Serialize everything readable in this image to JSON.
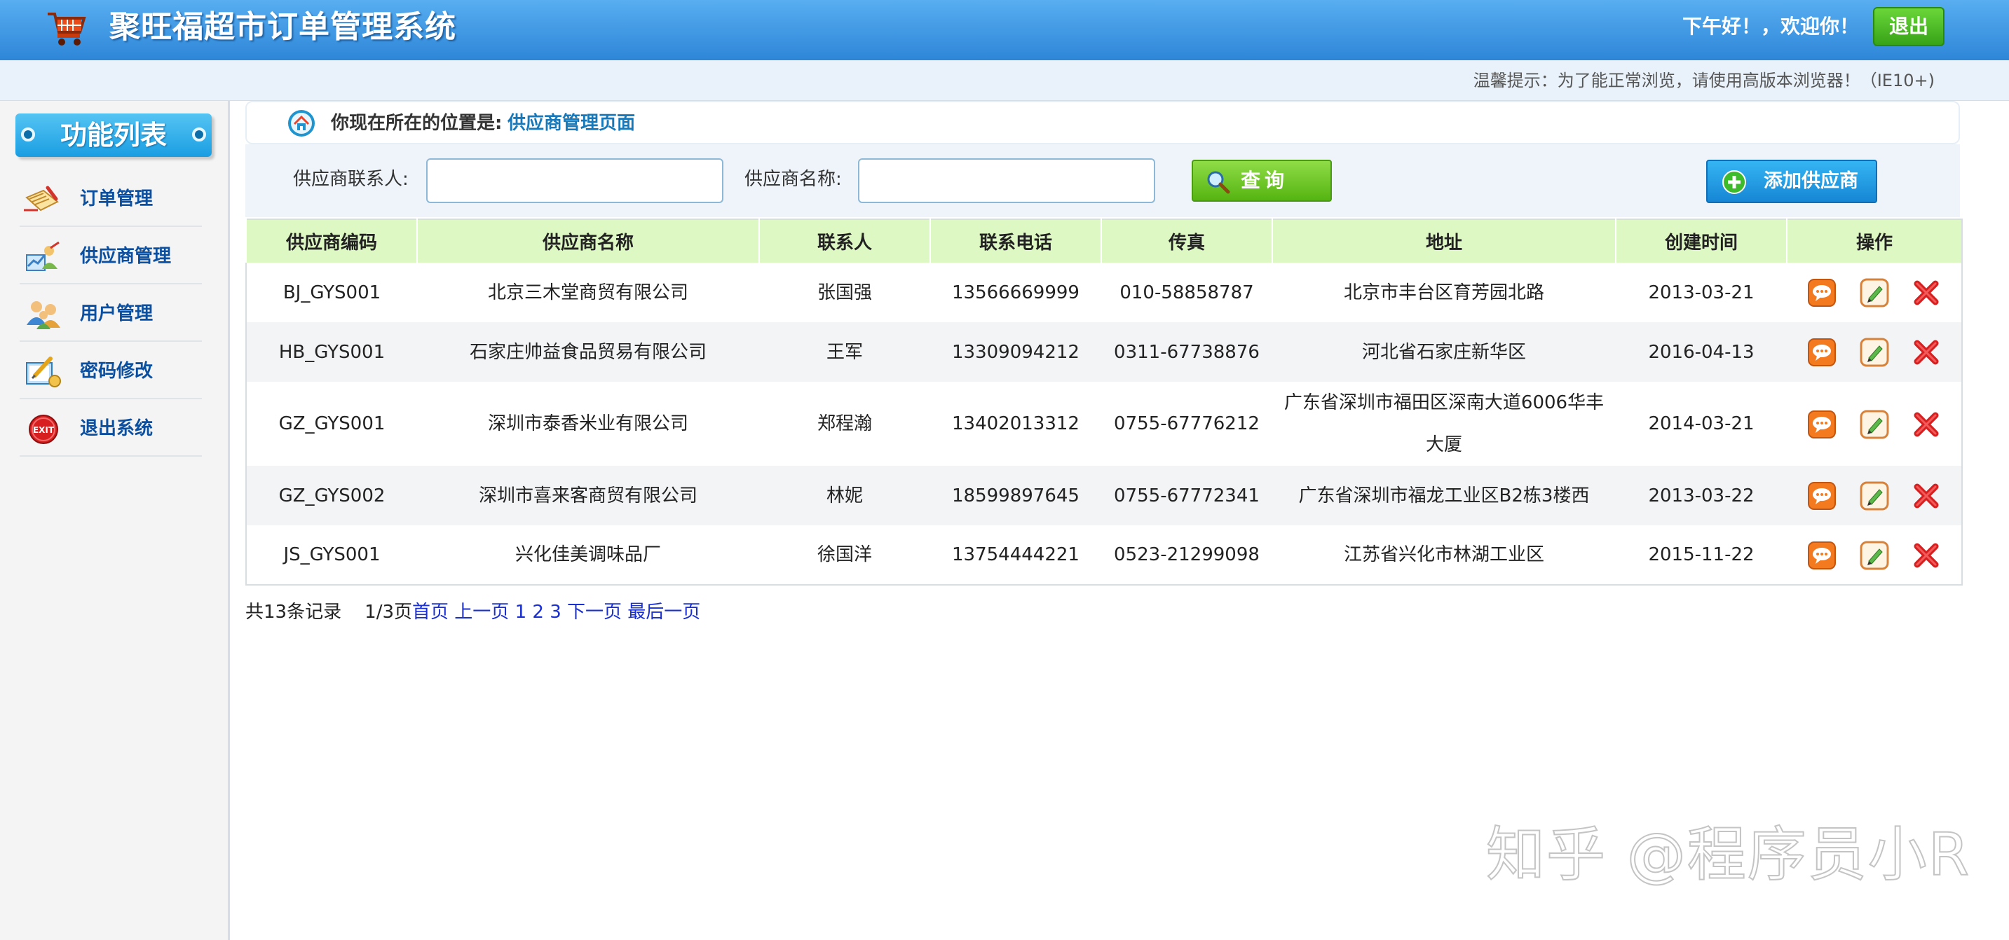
{
  "header": {
    "title": "聚旺福超市订单管理系统",
    "greeting": "下午好！，欢迎你！",
    "logout_label": "退出"
  },
  "tip": {
    "text": "温馨提示：为了能正常浏览，请使用高版本浏览器！（IE10+)"
  },
  "sidebar": {
    "title": "功能列表",
    "items": [
      {
        "label": "订单管理",
        "icon": "order-icon"
      },
      {
        "label": "供应商管理",
        "icon": "supplier-icon"
      },
      {
        "label": "用户管理",
        "icon": "users-icon"
      },
      {
        "label": "密码修改",
        "icon": "password-icon"
      },
      {
        "label": "退出系统",
        "icon": "exit-icon"
      }
    ]
  },
  "breadcrumb": {
    "prefix": "你现在所在的位置是:",
    "current": "供应商管理页面"
  },
  "search": {
    "contact_label": "供应商联系人:",
    "contact_value": "",
    "name_label": "供应商名称:",
    "name_value": "",
    "query_label": "查询",
    "add_label": "添加供应商"
  },
  "table": {
    "columns": [
      "供应商编码",
      "供应商名称",
      "联系人",
      "联系电话",
      "传真",
      "地址",
      "创建时间",
      "操作"
    ],
    "rows": [
      {
        "code": "BJ_GYS001",
        "name": "北京三木堂商贸有限公司",
        "contact": "张国强",
        "phone": "13566669999",
        "fax": "010-58858787",
        "address": "北京市丰台区育芳园北路",
        "created": "2013-03-21"
      },
      {
        "code": "HB_GYS001",
        "name": "石家庄帅益食品贸易有限公司",
        "contact": "王军",
        "phone": "13309094212",
        "fax": "0311-67738876",
        "address": "河北省石家庄新华区",
        "created": "2016-04-13"
      },
      {
        "code": "GZ_GYS001",
        "name": "深圳市泰香米业有限公司",
        "contact": "郑程瀚",
        "phone": "13402013312",
        "fax": "0755-67776212",
        "address": "广东省深圳市福田区深南大道6006华丰大厦",
        "created": "2014-03-21"
      },
      {
        "code": "GZ_GYS002",
        "name": "深圳市喜来客商贸有限公司",
        "contact": "林妮",
        "phone": "18599897645",
        "fax": "0755-67772341",
        "address": "广东省深圳市福龙工业区B2栋3楼西",
        "created": "2013-03-22"
      },
      {
        "code": "JS_GYS001",
        "name": "兴化佳美调味品厂",
        "contact": "徐国洋",
        "phone": "13754444221",
        "fax": "0523-21299098",
        "address": "江苏省兴化市林湖工业区",
        "created": "2015-11-22"
      }
    ]
  },
  "pager": {
    "total": "共13条记录",
    "page": "1/3页",
    "first": "首页",
    "prev": "上一页",
    "pages": [
      "1",
      "2",
      "3"
    ],
    "next": "下一页",
    "last": "最后一页"
  },
  "watermark": "知乎 @程序员小R",
  "colors": {
    "header_blue": "#3a94e0",
    "logout_green": "#45b51c",
    "table_header": "#def8c4",
    "link_blue": "#1a2fd0",
    "menu_text": "#0b4fa0"
  }
}
